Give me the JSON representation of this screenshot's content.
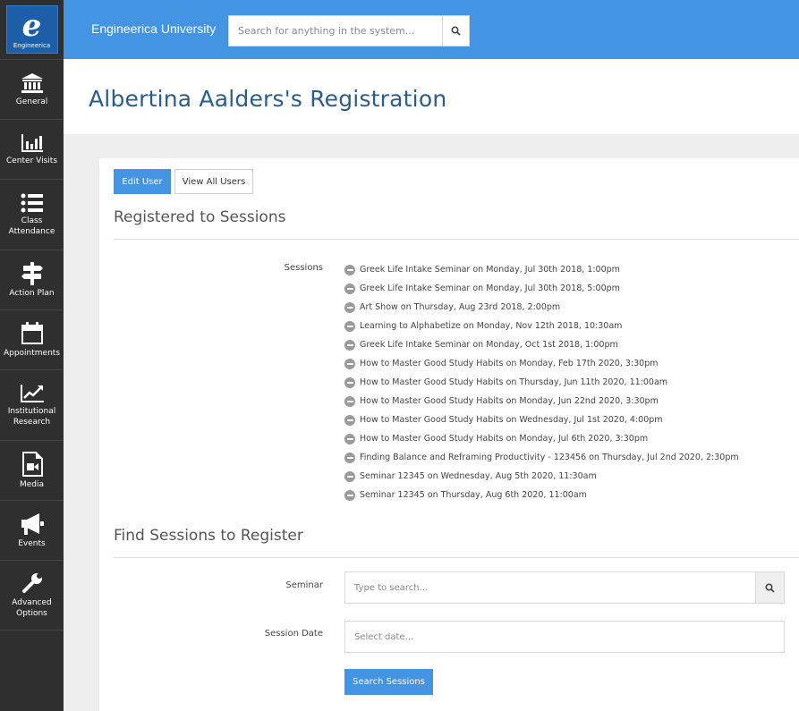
{
  "app": {
    "logo_letter": "e",
    "logo_text": "Engineerica",
    "brand": "Engineerica University"
  },
  "colors": {
    "primary": "#4494e4",
    "sidebar_bg": "#2f2f2f",
    "title_text": "#2a5d8a"
  },
  "search": {
    "placeholder": "Search for anything in the system...",
    "icon": "search-icon"
  },
  "sidebar": {
    "items": [
      {
        "label": "General",
        "icon": "bank-icon"
      },
      {
        "label": "Center Visits",
        "icon": "bar-chart-icon"
      },
      {
        "label": "Class Attendance",
        "icon": "list-icon"
      },
      {
        "label": "Action Plan",
        "icon": "signpost-icon"
      },
      {
        "label": "Appointments",
        "icon": "calendar-icon"
      },
      {
        "label": "Institutional Research",
        "icon": "trend-chart-icon"
      },
      {
        "label": "Media",
        "icon": "media-file-icon"
      },
      {
        "label": "Events",
        "icon": "megaphone-icon"
      },
      {
        "label": "Advanced Options",
        "icon": "wrench-icon"
      }
    ]
  },
  "page": {
    "title": "Albertina Aalders's Registration"
  },
  "actions": {
    "edit_user": "Edit User",
    "view_all_users": "View All Users"
  },
  "registered": {
    "heading": "Registered to Sessions",
    "label": "Sessions",
    "sessions": [
      "Greek Life Intake Seminar on Monday, Jul 30th 2018, 1:00pm",
      "Greek Life Intake Seminar on Monday, Jul 30th 2018, 5:00pm",
      "Art Show on Thursday, Aug 23rd 2018, 2:00pm",
      "Learning to Alphabetize on Monday, Nov 12th 2018, 10:30am",
      "Greek Life Intake Seminar on Monday, Oct 1st 2018, 1:00pm",
      "How to Master Good Study Habits on Monday, Feb 17th 2020, 3:30pm",
      "How to Master Good Study Habits on Thursday, Jun 11th 2020, 11:00am",
      "How to Master Good Study Habits on Monday, Jun 22nd 2020, 3:30pm",
      "How to Master Good Study Habits on Wednesday, Jul 1st 2020, 4:00pm",
      "How to Master Good Study Habits on Monday, Jul 6th 2020, 3:30pm",
      " Finding Balance and Reframing Productivity - 123456 on Thursday, Jul 2nd 2020, 2:30pm",
      "Seminar 12345 on Wednesday, Aug 5th 2020, 11:30am",
      "Seminar 12345 on Thursday, Aug 6th 2020, 11:00am"
    ]
  },
  "find": {
    "heading": "Find Sessions to Register",
    "seminar_label": "Seminar",
    "seminar_placeholder": "Type to search...",
    "date_label": "Session Date",
    "date_placeholder": "Select date...",
    "submit": "Search Sessions"
  }
}
